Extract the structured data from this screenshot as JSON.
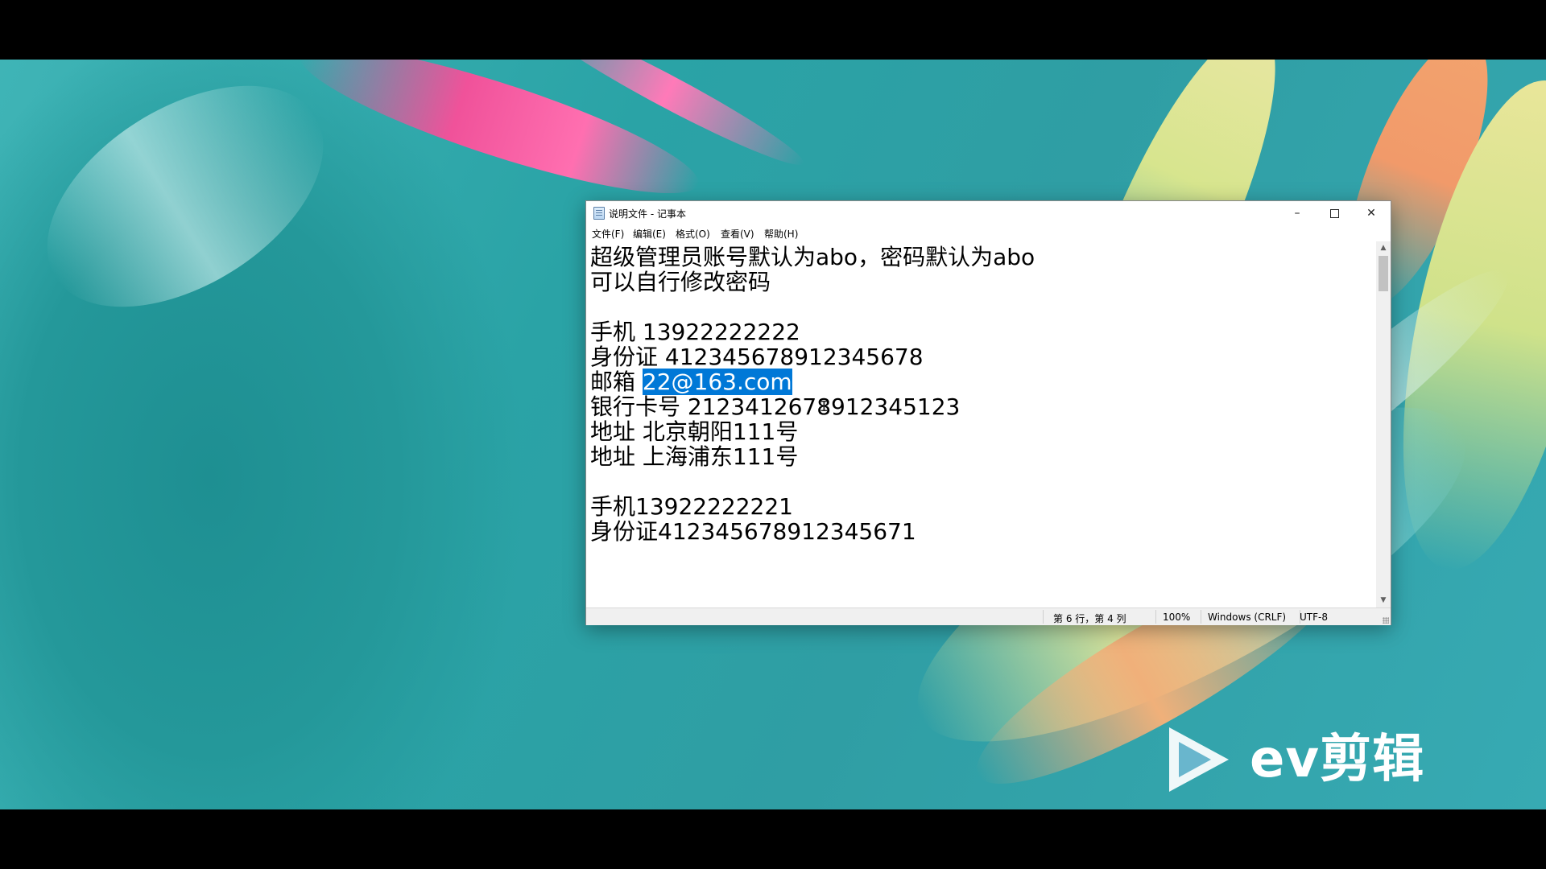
{
  "window": {
    "title": "说明文件 - 记事本",
    "controls": {
      "minimize": "–",
      "maximize": "",
      "close": "✕"
    }
  },
  "menu": [
    "文件(F)",
    "编辑(E)",
    "格式(O)",
    "查看(V)",
    "帮助(H)"
  ],
  "editor": {
    "lines": [
      "超级管理员账号默认为abo，密码默认为abo",
      "可以自行修改密码",
      "",
      "手机 13922222222",
      "身份证 412345678912345678",
      "邮箱 ",
      "银行卡号 2123412678912345123",
      "地址 北京朝阳111号",
      "地址 上海浦东111号",
      "",
      "手机13922222221",
      "身份证412345678912345671"
    ],
    "selected_text": "22@163.com",
    "selected_line_index": 5
  },
  "statusbar": {
    "position": "第 6 行，第 4 列",
    "zoom": "100%",
    "line_ending": "Windows (CRLF)",
    "encoding": "UTF-8"
  },
  "watermark": {
    "text": "ev剪辑"
  },
  "colors": {
    "selection": "#0078d7",
    "desktop": "#2aa3a6"
  }
}
